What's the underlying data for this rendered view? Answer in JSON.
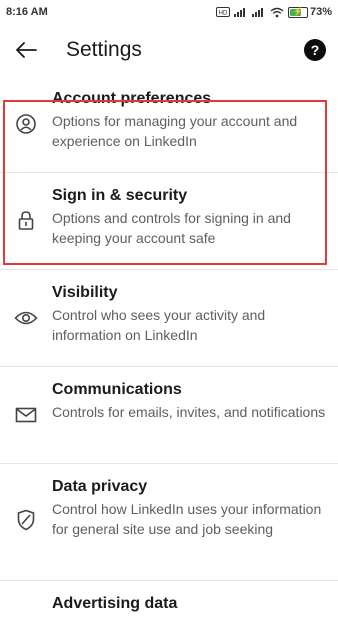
{
  "status_bar": {
    "time": "8:16 AM",
    "battery_percent": "73%",
    "battery_level": 0.73,
    "icons": [
      "volte-icon",
      "signal-icon",
      "signal-icon",
      "wifi-icon",
      "battery-charging-icon"
    ]
  },
  "header": {
    "title": "Settings",
    "back_icon": "arrow-left-icon",
    "help_icon": "question-mark-circle-icon"
  },
  "settings_items": [
    {
      "title": "Account preferences",
      "description": "Options for managing your account and experience on LinkedIn",
      "icon": "user-circle-icon"
    },
    {
      "title": "Sign in & security",
      "description": "Options and controls for signing in and keeping your account safe",
      "icon": "lock-icon",
      "highlighted": true
    },
    {
      "title": "Visibility",
      "description": "Control who sees your activity and information on LinkedIn",
      "icon": "eye-icon"
    },
    {
      "title": "Communications",
      "description": "Controls for emails, invites, and notifications",
      "icon": "envelope-icon"
    },
    {
      "title": "Data privacy",
      "description": "Control how LinkedIn uses your information for general site use and job seeking",
      "icon": "shield-icon"
    },
    {
      "title": "Advertising data",
      "description": "",
      "icon": ""
    }
  ],
  "colors": {
    "highlight_border": "#e03a3a",
    "battery_fill": "#4caf50"
  }
}
